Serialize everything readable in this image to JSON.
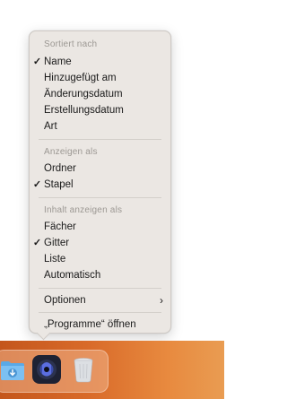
{
  "context_menu": {
    "sections": [
      {
        "header": "Sortiert nach",
        "items": [
          {
            "label": "Name",
            "checked": true
          },
          {
            "label": "Hinzugefügt am",
            "checked": false
          },
          {
            "label": "Änderungsdatum",
            "checked": false
          },
          {
            "label": "Erstellungsdatum",
            "checked": false
          },
          {
            "label": "Art",
            "checked": false
          }
        ]
      },
      {
        "header": "Anzeigen als",
        "items": [
          {
            "label": "Ordner",
            "checked": false
          },
          {
            "label": "Stapel",
            "checked": true
          }
        ]
      },
      {
        "header": "Inhalt anzeigen als",
        "items": [
          {
            "label": "Fächer",
            "checked": false
          },
          {
            "label": "Gitter",
            "checked": true
          },
          {
            "label": "Liste",
            "checked": false
          },
          {
            "label": "Automatisch",
            "checked": false
          }
        ]
      }
    ],
    "options_label": "Optionen",
    "open_label": "„Programme“ öffnen",
    "check_glyph": "✓",
    "submenu_glyph": "›"
  },
  "dock": {
    "items": [
      "downloads-folder-icon",
      "app-icon",
      "trash-icon"
    ]
  },
  "colors": {
    "menu_bg": "#ebe7e3",
    "header_text": "#9c9893",
    "item_text": "#1a1a1a",
    "dock_gradient_start": "#c4561c",
    "dock_gradient_end": "#e99c52"
  }
}
